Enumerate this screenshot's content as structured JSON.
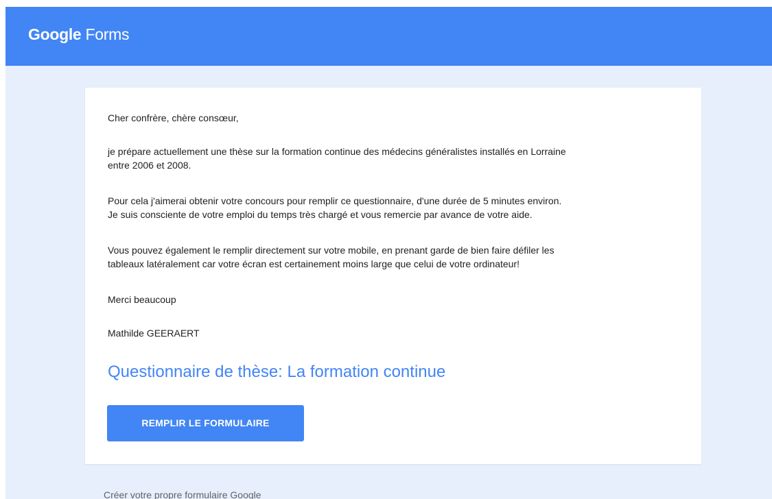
{
  "header": {
    "brand": "Google",
    "product": "Forms"
  },
  "message": {
    "greeting": "Cher confrère, chère consœur,",
    "intro_line1": "je prépare actuellement une thèse sur la formation continue des médecins généralistes installés en Lorraine",
    "intro_line2": "entre 2006 et 2008.",
    "request_line1": "Pour cela j'aimerai obtenir votre concours pour remplir ce questionnaire, d'une durée de 5 minutes environ.",
    "request_line2": "Je suis consciente de votre emploi du temps très chargé et vous remercie par avance de votre aide.",
    "mobile_line1": "Vous pouvez également le remplir directement sur votre mobile, en prenant garde de bien faire défiler les",
    "mobile_line2": "tableaux latéralement car votre écran est certainement moins large que celui de votre ordinateur!",
    "thanks": "Merci beaucoup",
    "signature": "Mathilde GEERAERT"
  },
  "form": {
    "title": "Questionnaire de thèse: La formation continue",
    "button_label": "REMPLIR LE FORMULAIRE"
  },
  "footer": {
    "link_text": "Créer votre propre formulaire Google"
  },
  "colors": {
    "header_blue": "#4285f4",
    "page_background": "#e8effc",
    "card_background": "#ffffff"
  }
}
